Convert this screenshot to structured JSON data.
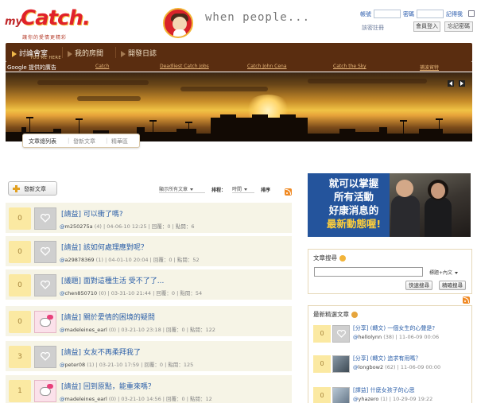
{
  "header": {
    "logo_prefix": "my",
    "logo_main": "Catch.",
    "logo_sub": "讓你的愛情更精彩",
    "tagline": "when people..."
  },
  "login": {
    "account_label": "帳號",
    "password_label": "密碼",
    "remember_label": "記得我",
    "forgot_link": "該密註冊",
    "member_login_button": "會員登入",
    "forgot_password_button": "忘記密碼"
  },
  "nav": {
    "items": [
      {
        "label": "討論會室"
      },
      {
        "label": "我的房間"
      },
      {
        "label": "開發日誌"
      }
    ],
    "youre_here": "YOU'RE HERE"
  },
  "ads": {
    "label": "Google 提供的廣告",
    "links": [
      "Catch",
      "Deadliest Catch Jobs",
      "Catch John Cena",
      "Catch the Sky",
      "捕波貿特"
    ]
  },
  "subtabs": [
    {
      "label": "文章總列表"
    },
    {
      "label": "發新文章"
    },
    {
      "label": "精華區"
    }
  ],
  "toolbar": {
    "post_button": "發新文章",
    "filter_select": "顯示所有文章",
    "sort_label": "排程：",
    "sort_select": "時間",
    "order_label": "排序"
  },
  "posts": [
    {
      "count": "0",
      "title": "[請益] 可以衝了嗎?",
      "user": "m250275a",
      "score": "(4)",
      "time": "04-06-10 12:25",
      "replies": "回覆：0",
      "views": "點閱：6",
      "avatar": "heart"
    },
    {
      "count": "0",
      "title": "[請益] 該如何處理應對呢？",
      "user": "a29878369",
      "score": "(1)",
      "time": "04-01-10 20:04",
      "replies": "回覆：0",
      "views": "點閱：52",
      "avatar": "heart"
    },
    {
      "count": "0",
      "title": "[議題] 面對這種生活 受不了了...",
      "user": "chen850710",
      "score": "(0)",
      "time": "03-31-10 21:44",
      "replies": "回覆：0",
      "views": "點閱：54",
      "avatar": "heart"
    },
    {
      "count": "0",
      "title": "[請益] 關於愛情的困境的疑問",
      "user": "madeleines_earl",
      "score": "(0)",
      "time": "03-21-10 23:18",
      "replies": "回覆：0",
      "views": "點閱：122",
      "avatar": "kitty"
    },
    {
      "count": "3",
      "title": "[請益] 女友不再柔拜我了",
      "user": "peter08",
      "score": "(1)",
      "time": "03-21-10 17:59",
      "replies": "回覆：0",
      "views": "點閱：125",
      "avatar": "heart"
    },
    {
      "count": "1",
      "title": "[請益] 回到原點，能重來嗎？",
      "user": "madeleines_earl",
      "score": "(0)",
      "time": "03-21-10 14:56",
      "replies": "回覆：0",
      "views": "點閱：12",
      "avatar": "kitty"
    }
  ],
  "ad": {
    "line1": "就可以掌握",
    "line2": "所有活動",
    "line3": "好康消息的",
    "line4": "最新動態喔!"
  },
  "search": {
    "title": "文章搜尋",
    "select": "標題+內文",
    "quick_button": "快速搜尋",
    "advanced_button": "精確搜尋"
  },
  "featured": {
    "title": "最新精選文章",
    "items": [
      {
        "count": "0",
        "title": "[分享] (轉文) 一個女生的心聲是?",
        "user": "hellolynn",
        "score": "(38)",
        "time": "11-06-09 00:06",
        "thumb": "heart"
      },
      {
        "count": "0",
        "title": "[分享] (轉文) 追求有用嗎？",
        "user": "longbow2",
        "score": "(62)",
        "time": "11-06-09 00:00",
        "thumb": "photo"
      },
      {
        "count": "0",
        "title": "[譯益] 什麼女孩子的心思",
        "user": "yhazero",
        "score": "(1)",
        "time": "10-29-09 19:22",
        "thumb": "photo2"
      }
    ]
  }
}
